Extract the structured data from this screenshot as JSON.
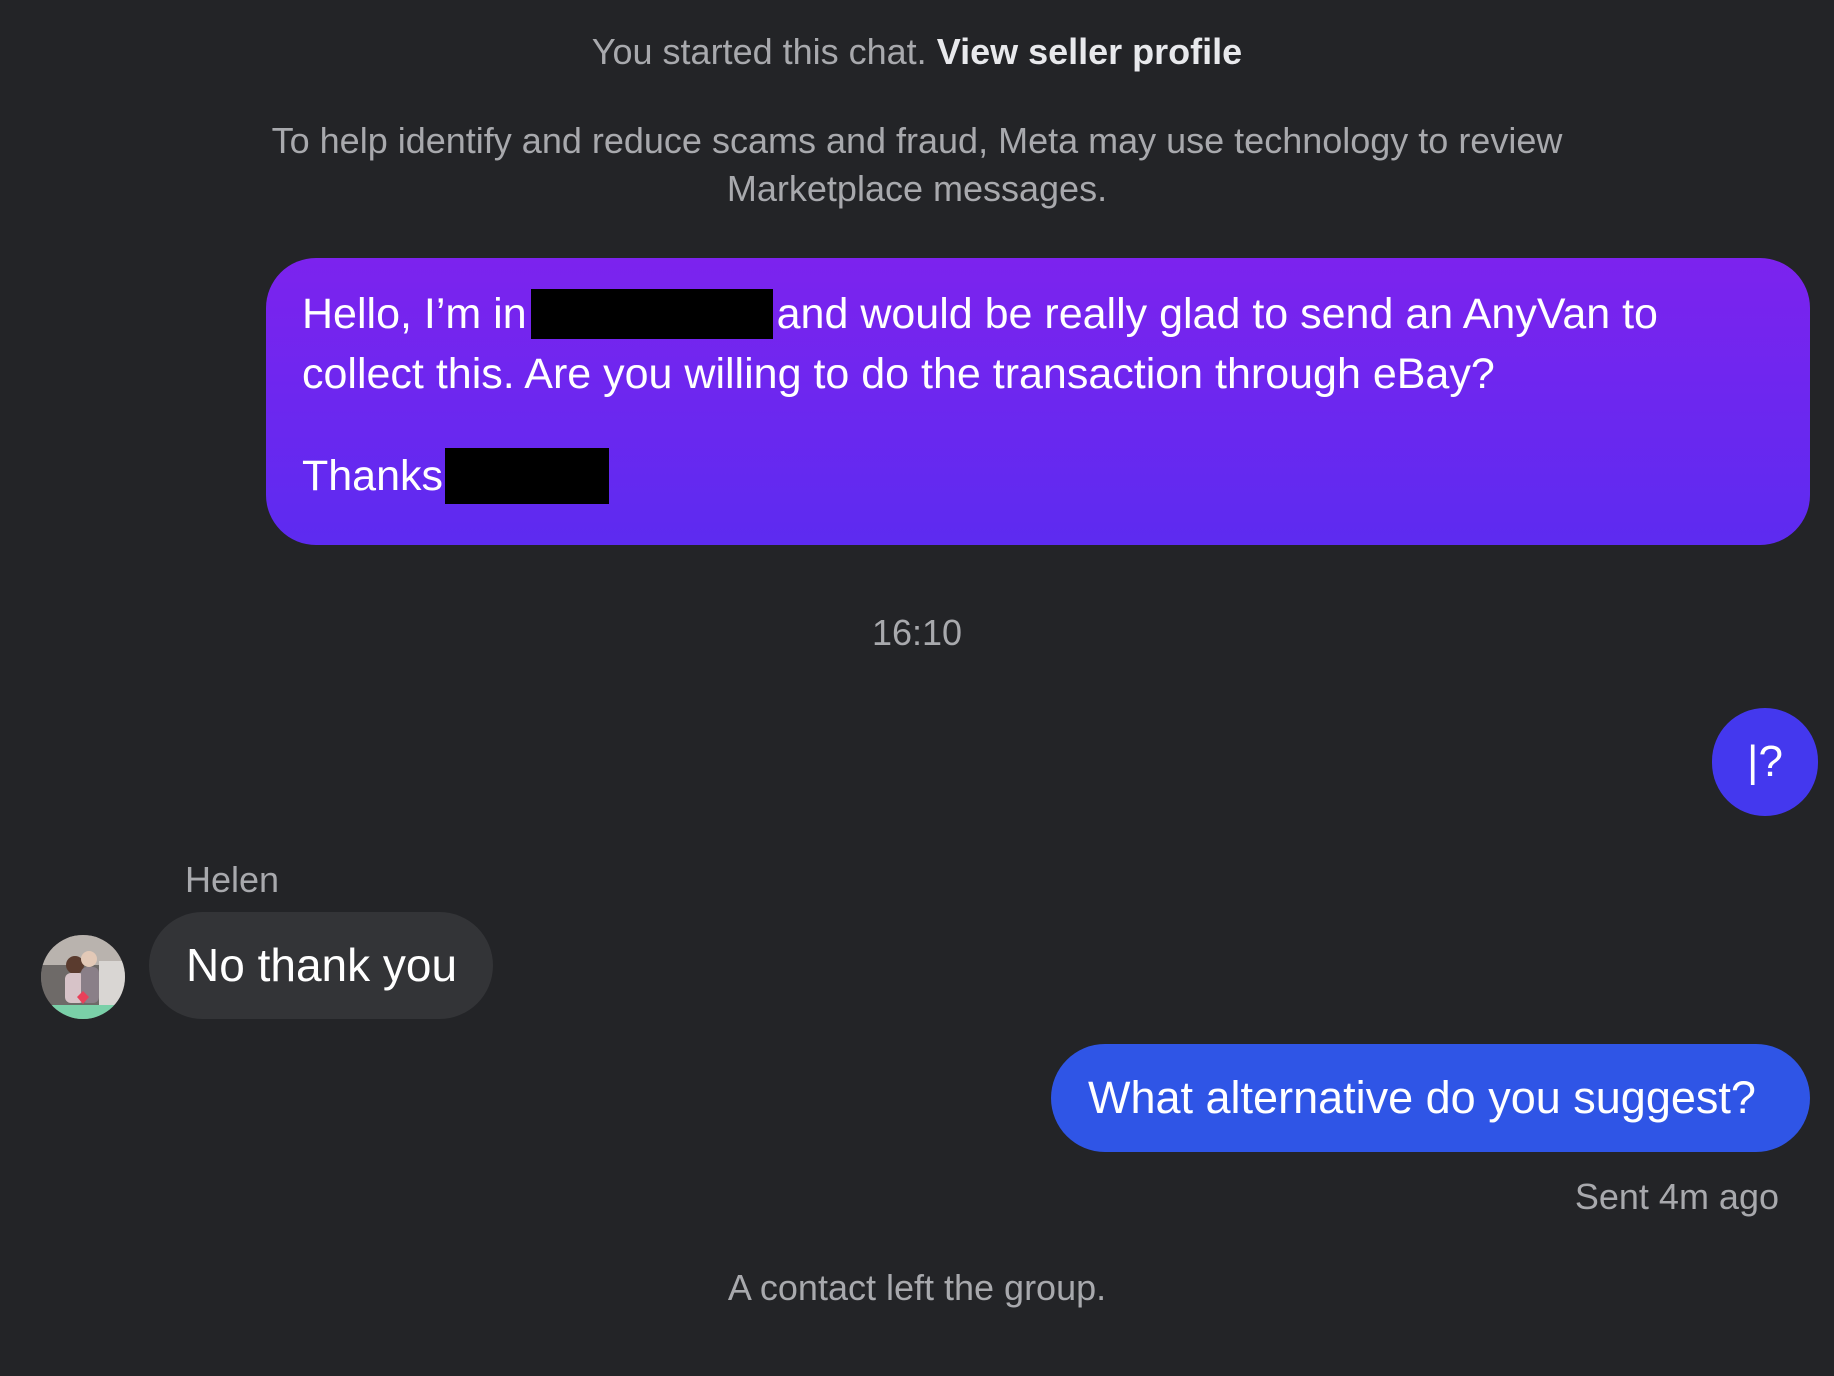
{
  "chat_start": {
    "text": "You started this chat.",
    "link_label": "View seller profile"
  },
  "notice": {
    "text": "To help identify and reduce scams and fraud, Meta may use technology to review Marketplace messages."
  },
  "messages": [
    {
      "sender": "me",
      "part1": "Hello, I’m in",
      "part2": "and would be really glad to send an AnyVan to collect this. Are you willing to do the transaction through eBay?",
      "signoff": "Thanks",
      "redacted": true
    },
    {
      "sender": "system",
      "text": "16:10"
    },
    {
      "sender": "me",
      "text": "|?"
    },
    {
      "sender": "Helen",
      "name": "Helen",
      "text": "No thank you"
    },
    {
      "sender": "me",
      "text": "What alternative do you suggest?",
      "status": "Sent 4m ago"
    }
  ],
  "footer_notice": "A contact left the group.",
  "colors": {
    "background": "#232427",
    "bubble_purple_top": "#7c23ee",
    "bubble_purple_bottom": "#5d2bf0",
    "bubble_indigo": "#4438ee",
    "bubble_blue": "#2f55e6",
    "bubble_incoming": "#333437",
    "muted_text": "#a8a9ad"
  }
}
